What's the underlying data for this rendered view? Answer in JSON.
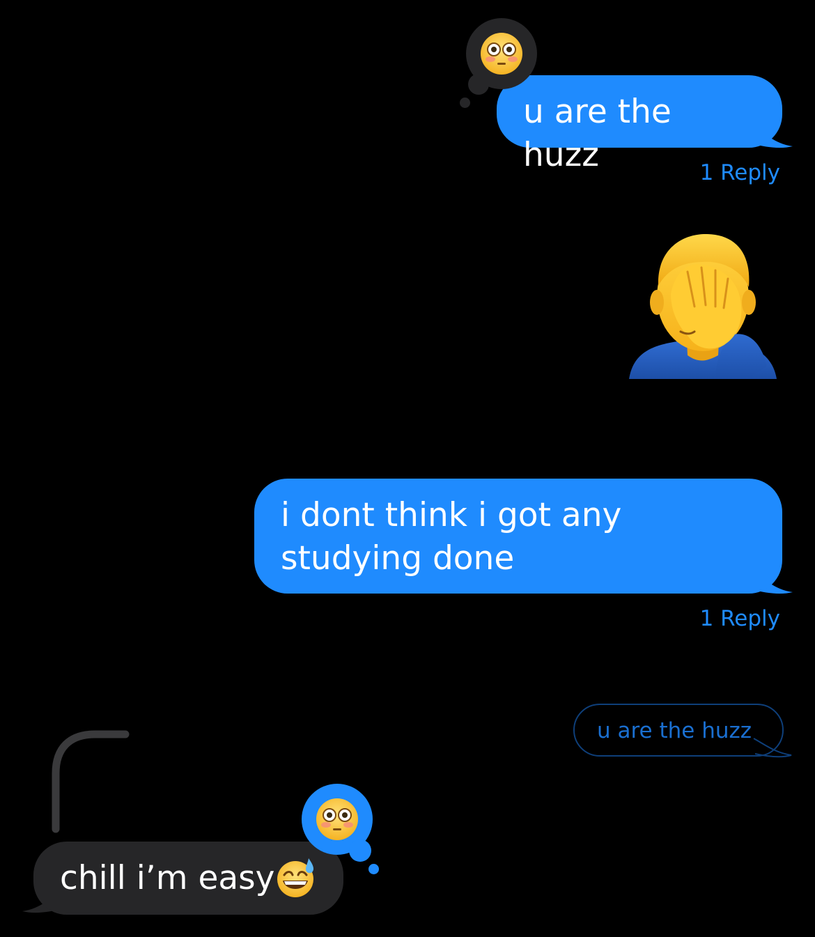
{
  "messages": [
    {
      "type": "sent",
      "text": "u are the huzz",
      "tapback_icon": "flushed-face-icon",
      "replies": "1 Reply"
    },
    {
      "type": "sent-emoji",
      "icon": "man-facepalming-icon"
    },
    {
      "type": "sent",
      "text": "i dont think i got any studying done",
      "replies": "1 Reply"
    },
    {
      "type": "quoted-reply",
      "text": "u are the huzz"
    },
    {
      "type": "received",
      "text": "chill i’m easy",
      "inline_icon": "grinning-face-with-sweat-icon",
      "tapback_icon": "flushed-face-icon"
    }
  ],
  "colors": {
    "background": "#000000",
    "sent_bubble": "#1f8bfe",
    "received_bubble": "#262628",
    "link_blue": "#1f8bfe",
    "tapback_dark": "#262628"
  }
}
